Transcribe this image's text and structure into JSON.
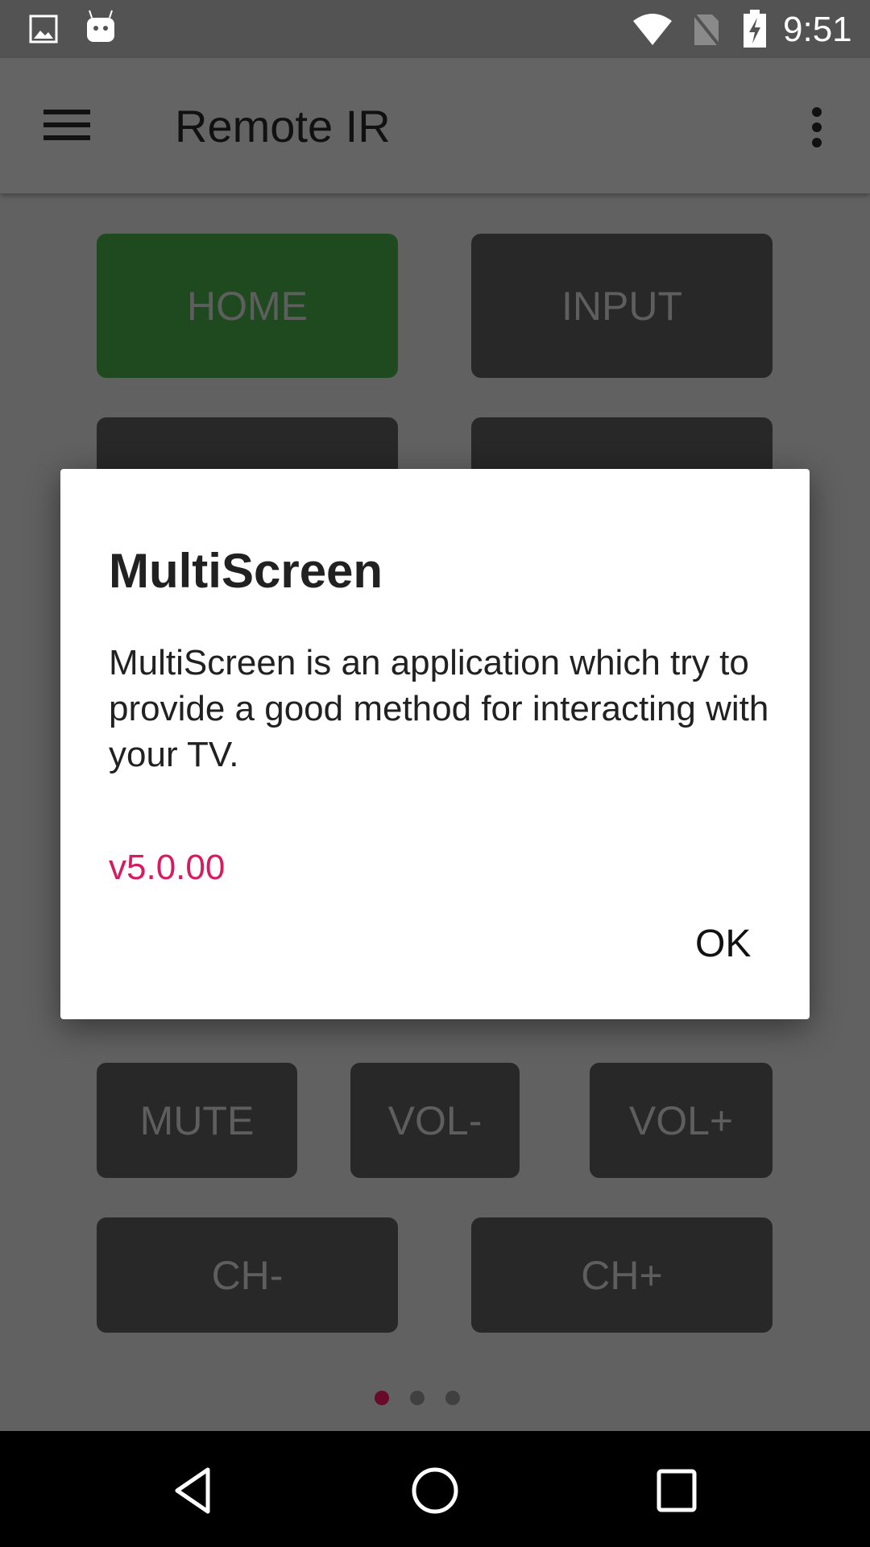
{
  "status_bar": {
    "time": "9:51",
    "icons": [
      "image-icon",
      "android-icon",
      "wifi-icon",
      "no-sim-icon",
      "battery-charging-icon"
    ]
  },
  "toolbar": {
    "title": "Remote IR",
    "menu_icon": "hamburger-icon",
    "overflow_icon": "more-vert-icon"
  },
  "remote": {
    "home": "HOME",
    "input": "INPUT",
    "mute": "MUTE",
    "vol_down": "VOL-",
    "vol_up": "VOL+",
    "ch_down": "CH-",
    "ch_up": "CH+",
    "active_color": "#1f4a20"
  },
  "pager": {
    "pages": 3,
    "current": 1,
    "accent": "#6a0a2a"
  },
  "dialog": {
    "title": "MultiScreen",
    "body": "MultiScreen is an application which try to provide a good method for interacting with your TV.",
    "version": "v5.0.00",
    "ok": "OK",
    "version_color": "#d81b60"
  },
  "nav_bar": {
    "icons": [
      "back-icon",
      "home-icon",
      "recents-icon"
    ]
  }
}
